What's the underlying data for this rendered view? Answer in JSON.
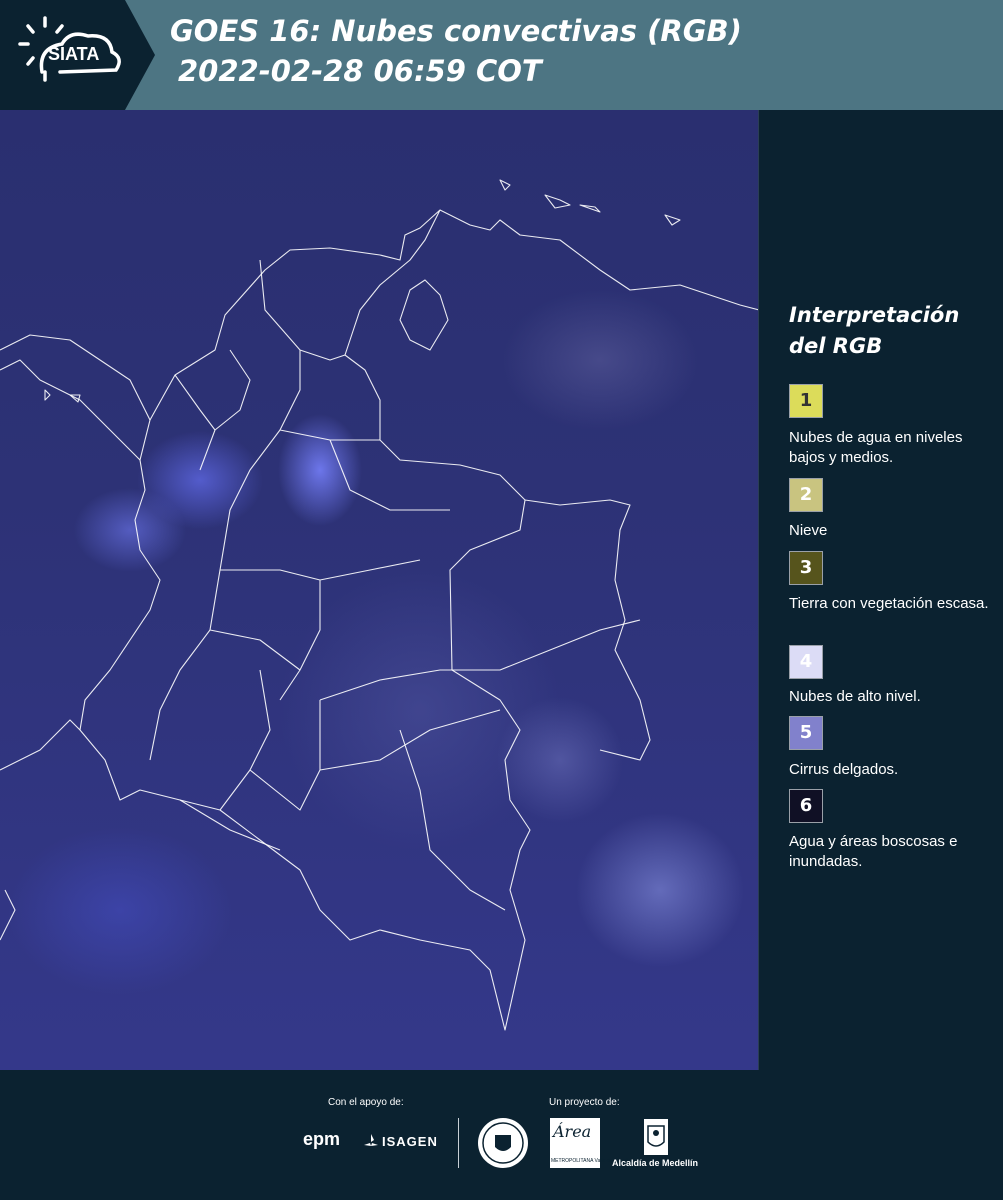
{
  "header": {
    "logo_text": "SIATA",
    "title_line1": "GOES 16: Nubes convectivas (RGB)",
    "title_line2": "2022-02-28 06:59 COT",
    "colors": {
      "bar": "#4d7583",
      "logo_bg": "#0b2230"
    }
  },
  "legend": {
    "title": "Interpretación del RGB",
    "items": [
      {
        "number": "1",
        "label": "Nubes de agua en niveles bajos y medios.",
        "color": "#dcdc5a",
        "text_color": "#333333"
      },
      {
        "number": "2",
        "label": "Nieve",
        "color": "#c9c480",
        "text_color": "#ffffff"
      },
      {
        "number": "3",
        "label": "Tierra con vegetación escasa.",
        "color": "#56541c",
        "text_color": "#ffffff"
      },
      {
        "number": "4",
        "label": "Nubes de alto nivel.",
        "color": "#dcdcf6",
        "text_color": "#ffffff"
      },
      {
        "number": "5",
        "label": "Cirrus delgados.",
        "color": "#8181cc",
        "text_color": "#ffffff"
      },
      {
        "number": "6",
        "label": "Agua y áreas boscosas e inundadas.",
        "color": "#101025",
        "text_color": "#ffffff"
      }
    ]
  },
  "footer": {
    "support_label": "Con el apoyo de:",
    "project_label": "Un proyecto de:",
    "sponsors": [
      "epm",
      "ISAGEN"
    ],
    "area_logo_text": "Área",
    "area_logo_sub": "METROPOLITANA Valle de Aburrá",
    "alcaldia_text": "Alcaldía de Medellín"
  }
}
